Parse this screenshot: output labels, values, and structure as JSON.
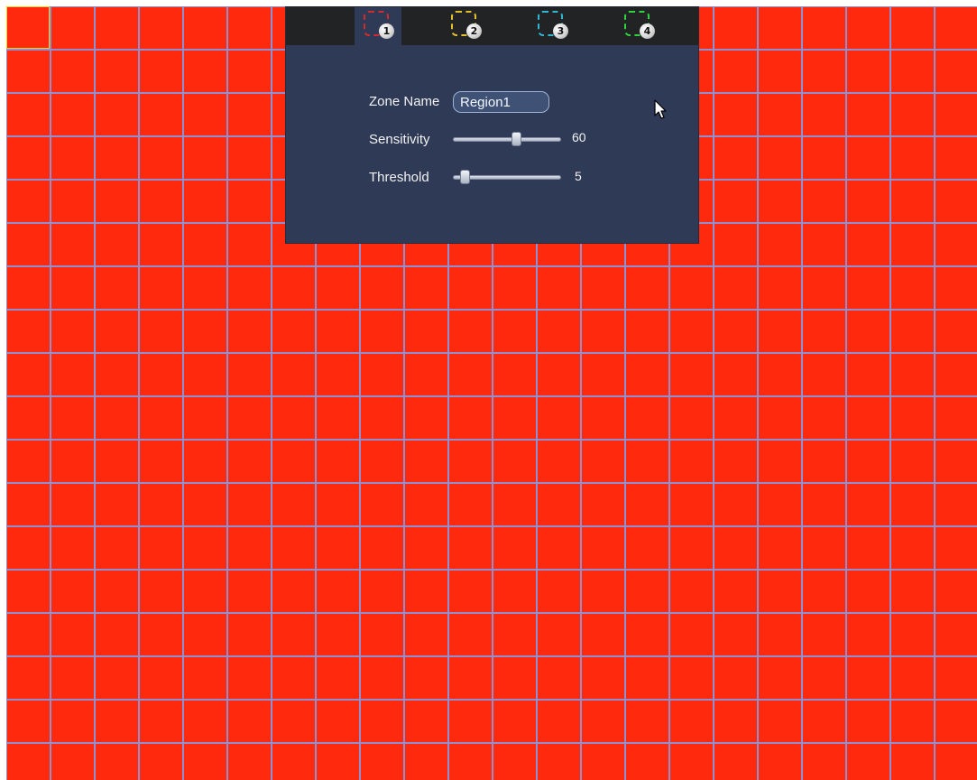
{
  "tabs": [
    {
      "number": "1",
      "color": "#d22b2b",
      "active": true
    },
    {
      "number": "2",
      "color": "#e6c02b",
      "active": false
    },
    {
      "number": "3",
      "color": "#2fb7d6",
      "active": false
    },
    {
      "number": "4",
      "color": "#2fd33c",
      "active": false
    }
  ],
  "zone_name": {
    "label": "Zone Name",
    "value": "Region1"
  },
  "sensitivity": {
    "label": "Sensitivity",
    "value": "60",
    "fraction": 0.6
  },
  "threshold": {
    "label": "Threshold",
    "value": "5",
    "fraction": 0.05
  },
  "colors": {
    "grid_fill": "#ff2a0e",
    "grid_line": "#8f8fd3",
    "panel_bg": "#2e3a56",
    "tabbar_bg": "#222325"
  }
}
